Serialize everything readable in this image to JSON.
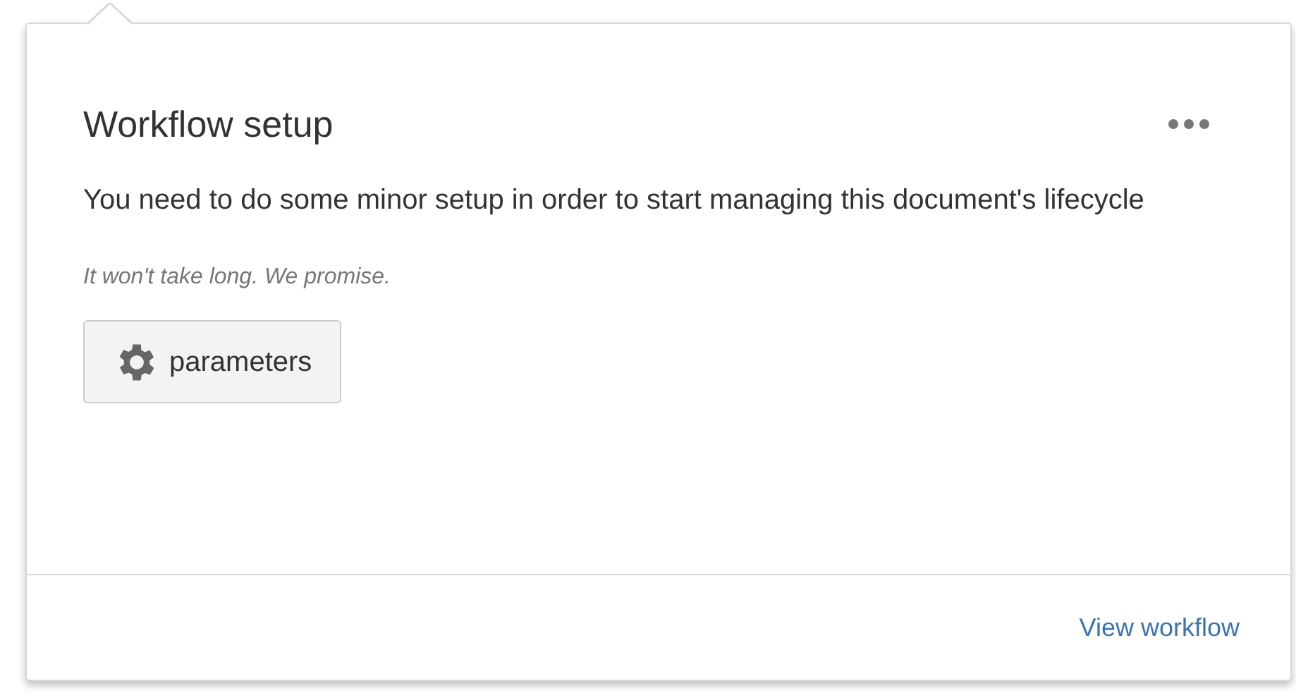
{
  "card": {
    "title": "Workflow setup",
    "message": "You need to do some minor setup in order to start managing this document's lifecycle",
    "note": "It won't take long. We promise.",
    "button": {
      "label": "parameters"
    },
    "footer_link": "View workflow"
  }
}
